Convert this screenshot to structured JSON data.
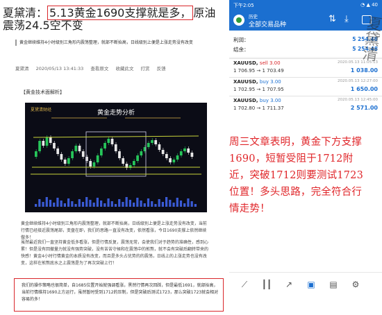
{
  "article": {
    "title_prefix": "夏黛清：",
    "title_highlight": "5.13黄金1690支撑就是多，",
    "title_suffix": "原油震荡24.5空不变",
    "lead": "黄金继续维持4小时级别三角形内震荡整理，就部不断抬高，日线级别上便是上涨走势没有改变",
    "author": "夏黛清",
    "datetime": "2020/05/13 13:41:33",
    "actions": [
      "查看原文",
      "收藏此文",
      "打赏",
      "反馈"
    ],
    "section_label": "【黄金技术面解析】",
    "chart_title": "黄金走势分析",
    "chart_logo": "夏黛清财经",
    "p1": "黄金继续维持4小时级别三角形内震荡整理，就部不断抬高，日线级别上便是上涨走势没有改变，当前行情已经接近震荡尾部，变盘在即，我们的思路一直没有改变，依然看涨，今日1690支撑上依然继续做多！",
    "p2": "虽然最近我们一直坚持黄金低多看涨，但是行情反复，震荡无常，会使我们对于趋势的准确性，感到心累！但是没有回撤量力就没有强势突破，没有苦苦守候和在震荡中的煎熬，就不会有突破后翻转带来的快感！黄金4小时行情黄金的本质没有改变，而且是多头占优势的的震荡，日线上的上涨走势也没有改变，这样在煎熬底水之上震荡是为了再次突破上行！",
    "quote": "我们的操作策略也很简单，自1685位置开始就强调看涨，黑然行情再次回踩，但是最低1691，就部抬高，当前行情维持1690上方运行，虽然暂时受到1712的压制，但是突破后测试1723，那么突破1723就会相对容易的多！"
  },
  "note": "周三文章表明，黄金下方支撑1690，短暂受阻于1712附近，突破1712则要测试1723位置！多头思路，完全符合行情走势！",
  "phone": {
    "status_time": "下午2:05",
    "status_icons": "◔ ▲ 40",
    "app_subtitle": "历史",
    "app_title": "全部交易品种",
    "summary": [
      {
        "label": "利润：",
        "value": "5 254.48"
      },
      {
        "label": "结余：",
        "value": "5 254.48"
      }
    ],
    "trades": [
      {
        "symbol": "XAUUSD,",
        "side": "sell 3.00",
        "side_type": "sell",
        "prices": "1 706.95 → 1 703.49",
        "time": "2020.05.13 11:05:13",
        "pnl": "1 038.00"
      },
      {
        "symbol": "XAUUSD,",
        "side": "buy 3.00",
        "side_type": "buy",
        "prices": "1 702.95 → 1 707.95",
        "time": "2020.05.13 12:27:00",
        "pnl": "1 650.00"
      },
      {
        "symbol": "XAUUSD,",
        "side": "buy 3.00",
        "side_type": "buy",
        "prices": "1 702.80 → 1 711.37",
        "time": "2020.05.13 12:45:00",
        "pnl": "2 571.00"
      }
    ],
    "nav_icons": [
      "chart-line-icon",
      "candlestick-icon",
      "trend-icon",
      "inbox-icon",
      "news-icon",
      "settings-icon"
    ]
  },
  "watermark": "夏黛清",
  "colors": {
    "accent": "#1b6fd0",
    "highlight": "#d9262a",
    "chart_bg": "#0b0c16"
  }
}
